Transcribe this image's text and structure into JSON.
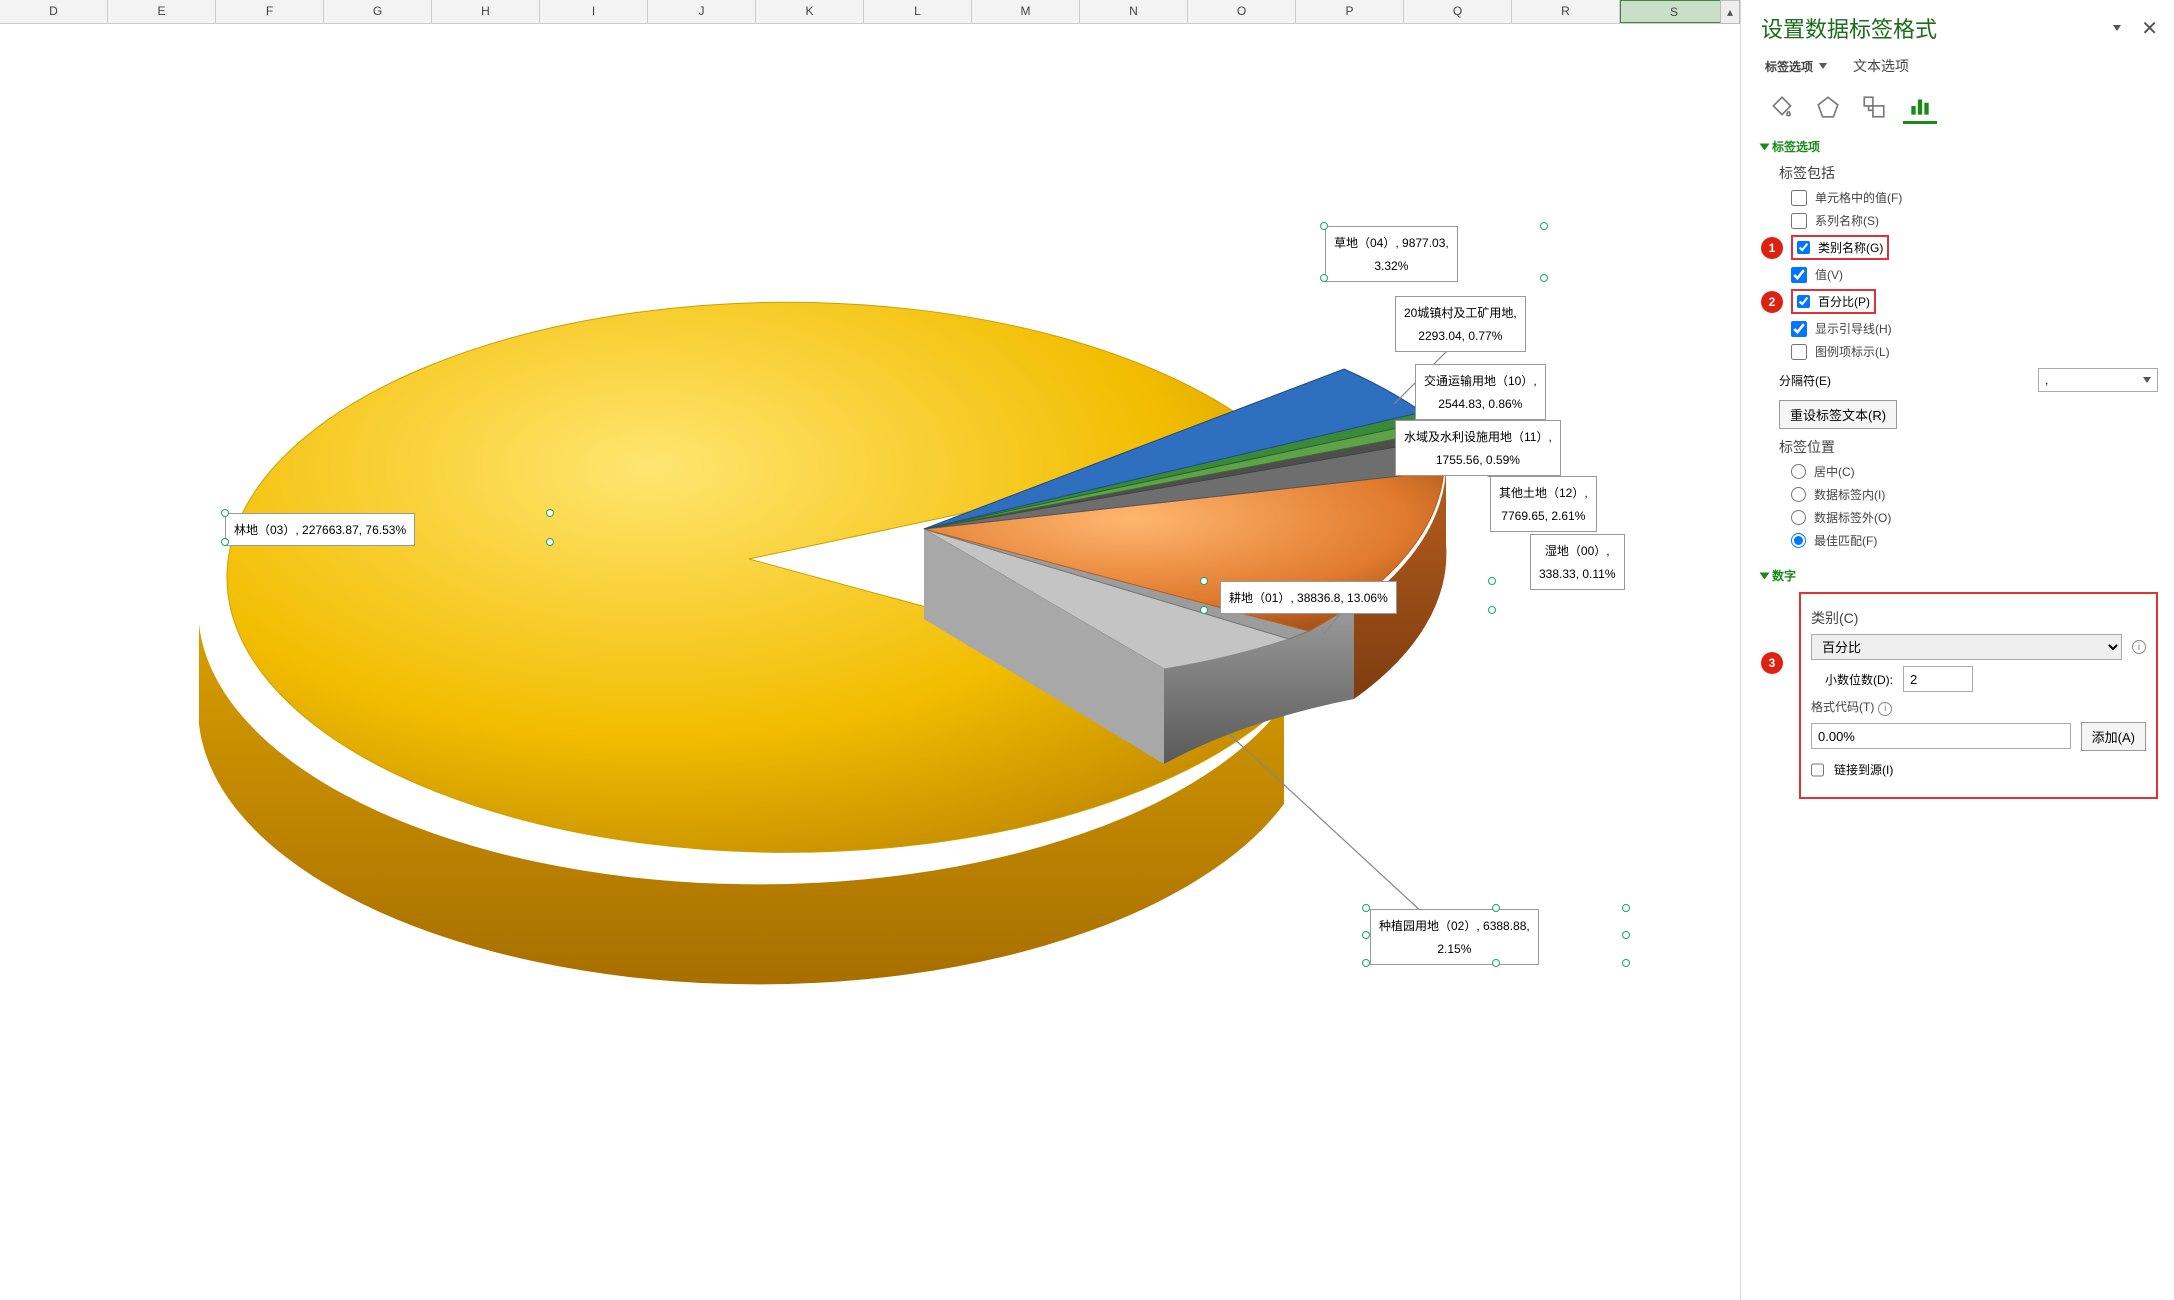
{
  "columns": [
    "D",
    "E",
    "F",
    "G",
    "H",
    "I",
    "J",
    "K",
    "L",
    "M",
    "N",
    "O",
    "P",
    "Q",
    "R",
    "S"
  ],
  "selected_col": "S",
  "panel": {
    "title": "设置数据标签格式",
    "tabs": {
      "options": "标签选项",
      "text": "文本选项"
    },
    "section_label_opts": "标签选项",
    "label_includes": "标签包括",
    "cb_cell_val": "单元格中的值(F)",
    "cb_series": "系列名称(S)",
    "cb_category": "类别名称(G)",
    "cb_value": "值(V)",
    "cb_percent": "百分比(P)",
    "cb_leader": "显示引导线(H)",
    "cb_legendkey": "图例项标示(L)",
    "sep_label": "分隔符(E)",
    "sep_value": ", ",
    "reset_btn": "重设标签文本(R)",
    "pos_label": "标签位置",
    "pos_center": "居中(C)",
    "pos_inside": "数据标签内(I)",
    "pos_outside": "数据标签外(O)",
    "pos_bestfit": "最佳匹配(F)",
    "section_number": "数字",
    "num_category_label": "类别(C)",
    "num_category_value": "百分比",
    "decimals_label": "小数位数(D):",
    "decimals_value": "2",
    "format_code_label": "格式代码(T)",
    "format_code_value": "0.00%",
    "add_btn": "添加(A)",
    "link_source": "链接到源(I)"
  },
  "chart_data": {
    "type": "pie",
    "series": [
      {
        "name": "林地（03）",
        "value": 227663.87,
        "percent": 76.53,
        "color": "#f0b400"
      },
      {
        "name": "草地（04）",
        "value": 9877.03,
        "percent": 3.32,
        "color": "#2e6fbf"
      },
      {
        "name": "20城镇村及工矿用地",
        "value": 2293.04,
        "percent": 0.77,
        "color": "#3fa23f"
      },
      {
        "name": "交通运输用地（10）",
        "value": 2544.83,
        "percent": 0.86,
        "color": "#6aa04a"
      },
      {
        "name": "水域及水利设施用地（11）",
        "value": 1755.56,
        "percent": 0.59,
        "color": "#555555"
      },
      {
        "name": "其他土地（12）",
        "value": 7769.65,
        "percent": 2.61,
        "color": "#7a7a7a"
      },
      {
        "name": "湿地（00）",
        "value": 338.33,
        "percent": 0.11,
        "color": "#a0a0a0"
      },
      {
        "name": "耕地（01）",
        "value": 38836.8,
        "percent": 13.06,
        "color": "#e07a2e"
      },
      {
        "name": "种植园用地（02）",
        "value": 6388.88,
        "percent": 2.15,
        "color": "#bdbdbd"
      }
    ]
  },
  "labels_text": {
    "l0": "林地（03）, 227663.87, 76.53%",
    "l1a": "草地（04）, 9877.03,",
    "l1b": "3.32%",
    "l2a": "20城镇村及工矿用地,",
    "l2b": "2293.04, 0.77%",
    "l3a": "交通运输用地（10）,",
    "l3b": "2544.83, 0.86%",
    "l4a": "水域及水利设施用地（11）,",
    "l4b": "1755.56, 0.59%",
    "l5a": "其他土地（12）,",
    "l5b": "7769.65, 2.61%",
    "l6a": "湿地（00）,",
    "l6b": "338.33, 0.11%",
    "l7": "耕地（01）, 38836.8, 13.06%",
    "l8a": "种植园用地（02）, 6388.88,",
    "l8b": "2.15%"
  }
}
